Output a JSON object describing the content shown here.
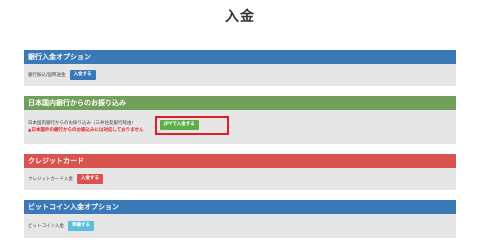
{
  "page": {
    "title": "入金"
  },
  "colors": {
    "blue": "#3a78b8",
    "green": "#70a05a",
    "red": "#d9534f",
    "light_blue": "#5bc0de",
    "highlight": "#e02020"
  },
  "bank_options": {
    "header": "銀行入金オプション",
    "label": "銀行振込/国際送金",
    "button": "入金する"
  },
  "domestic_transfer": {
    "header": "日本国内銀行からのお振り込み",
    "label": "日本国内銀行からのお振り込み（三井住友銀行経由）",
    "button": "JPYで入金する",
    "warning": "▲日本国外の銀行からのお振込みには対応しておりません"
  },
  "credit_card": {
    "header": "クレジットカード",
    "label": "クレジットカード入金",
    "button": "入金する"
  },
  "bitcoin": {
    "header": "ビットコイン入金オプション",
    "label": "ビットコイン入金",
    "button": "準備する"
  }
}
